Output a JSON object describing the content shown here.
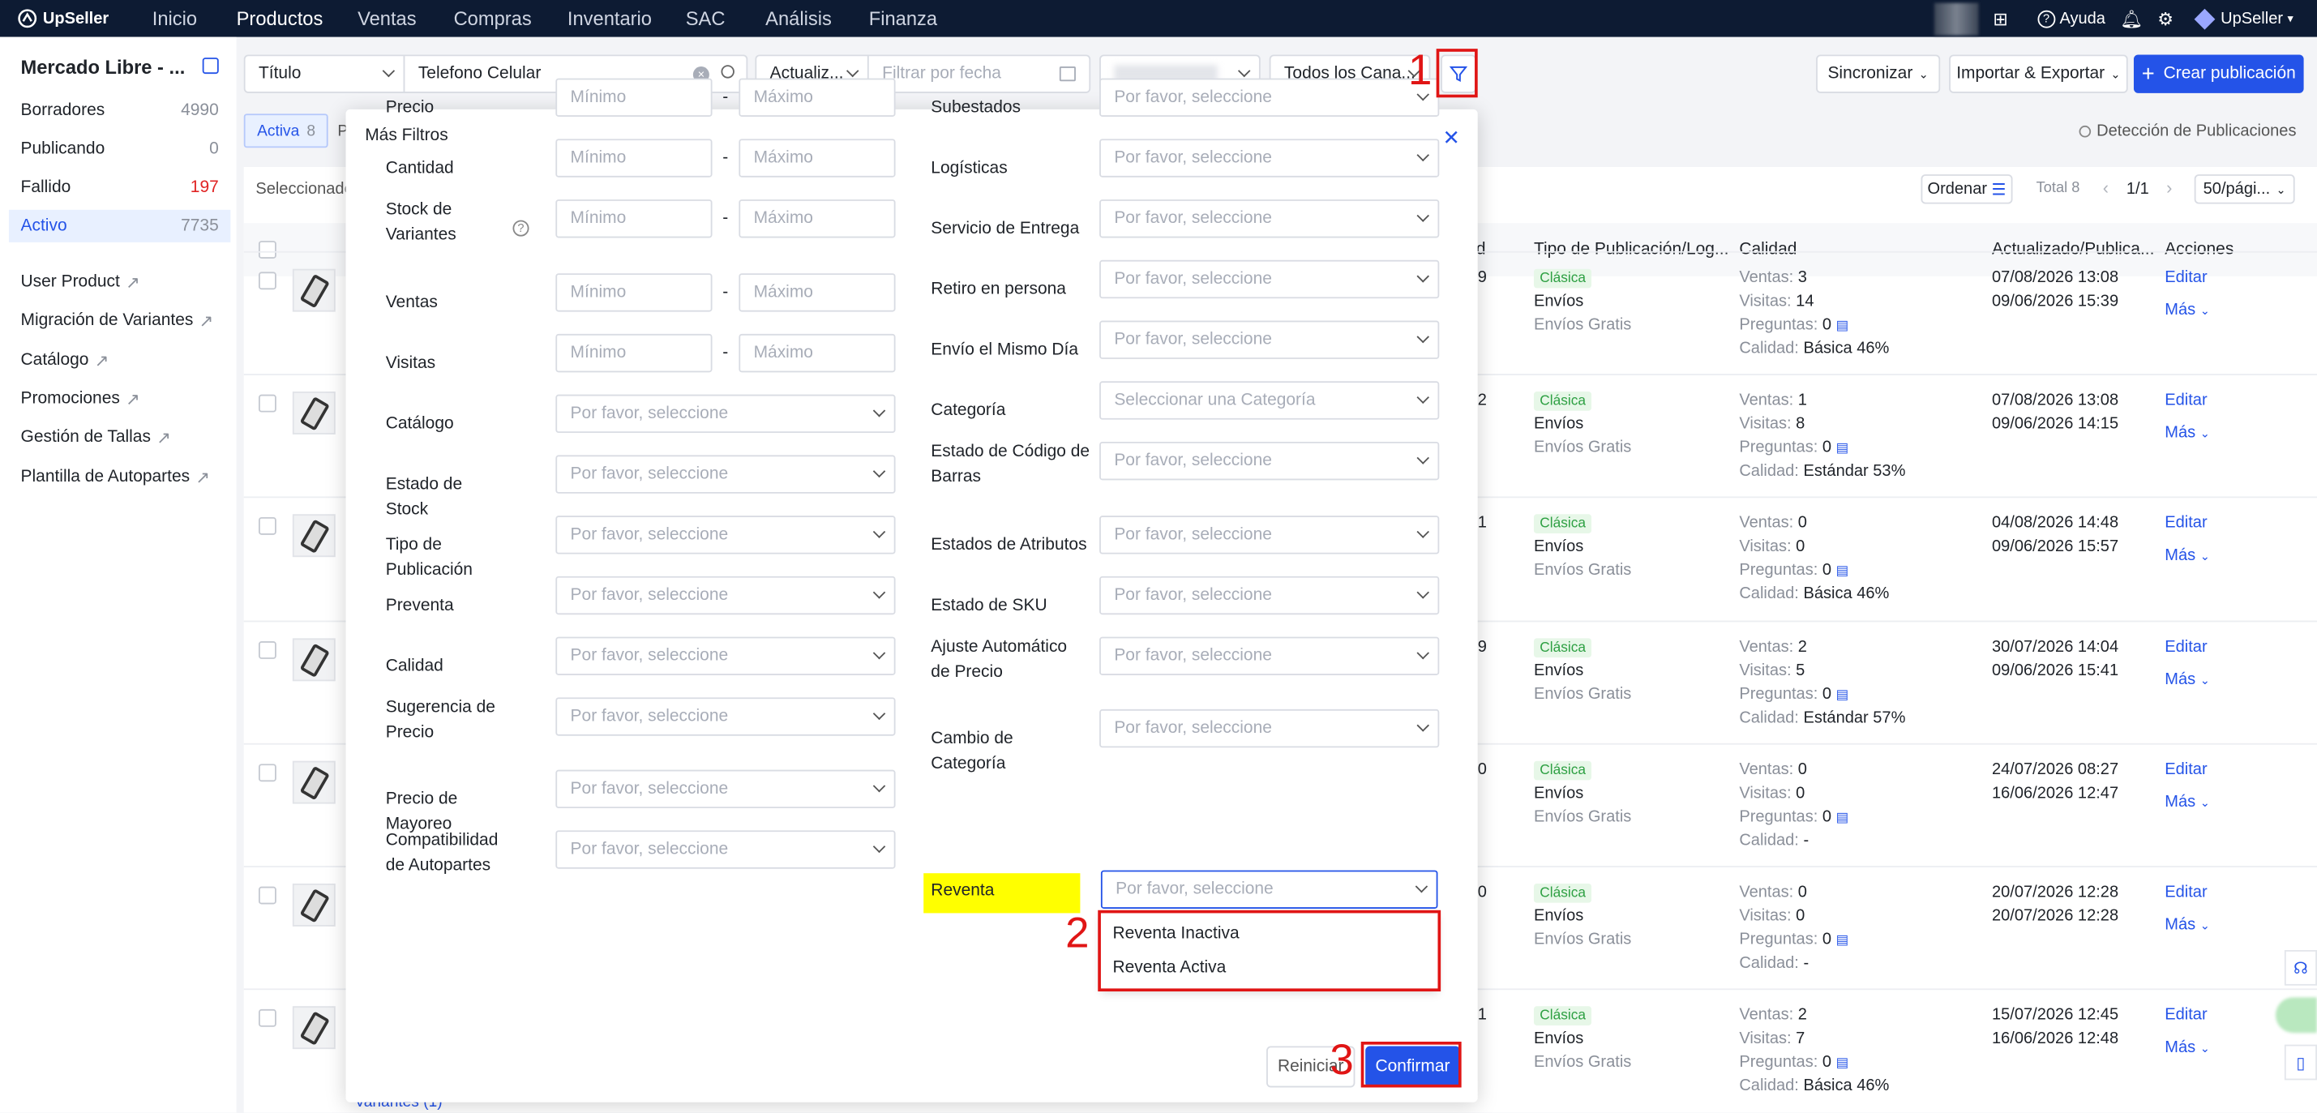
{
  "topbar": {
    "brand": "UpSeller",
    "nav": [
      "Inicio",
      "Productos",
      "Ventas",
      "Compras",
      "Inventario",
      "SAC",
      "Análisis",
      "Finanza"
    ],
    "active_nav": "Productos",
    "help": "Ayuda",
    "account": "UpSeller"
  },
  "sidebar": {
    "title": "Mercado Libre - ...",
    "items": [
      {
        "label": "Borradores",
        "count": "4990"
      },
      {
        "label": "Publicando",
        "count": "0"
      },
      {
        "label": "Fallido",
        "count": "197"
      },
      {
        "label": "Activo",
        "count": "7735"
      }
    ],
    "links": [
      "User Product",
      "Migración de Variantes",
      "Catálogo",
      "Promociones",
      "Gestión de Tallas",
      "Plantilla de Autopartes"
    ]
  },
  "toolbar": {
    "search_field": "Título",
    "search_value": "Telefono Celular",
    "date_type": "Actualiz...",
    "date_placeholder": "Filtrar por fecha",
    "channels": "Todos los Cana...",
    "sync": "Sincronizar",
    "import_export": "Importar & Exportar",
    "create": "Crear publicación",
    "detection": "Detección de Publicaciones"
  },
  "tabs": {
    "active": "Activa",
    "active_count": "8",
    "next": "P"
  },
  "listbar": {
    "selected": "Seleccionado",
    "sort": "Ordenar",
    "total": "Total 8",
    "page": "1/1",
    "per_page": "50/pági..."
  },
  "table": {
    "headers": {
      "qty": "d",
      "type": "Tipo de Publicación/Log...",
      "quality": "Calidad",
      "updated": "Actualizado/Publica...",
      "actions": "Acciones"
    },
    "quality_labels": {
      "sales": "Ventas:",
      "visits": "Visitas:",
      "questions": "Preguntas:",
      "quality": "Calidad:"
    },
    "rows": [
      {
        "qty": "9",
        "tag": "Clásica",
        "ship": "Envíos",
        "free": "Envíos Gratis",
        "sales": "3",
        "visits": "14",
        "questions": "0",
        "quality": "Básica 46%",
        "updated": "07/08/2026 13:08",
        "published": "09/06/2026 15:39",
        "edit": "Editar",
        "more": "Más"
      },
      {
        "qty": "2",
        "tag": "Clásica",
        "ship": "Envíos",
        "free": "Envíos Gratis",
        "sales": "1",
        "visits": "8",
        "questions": "0",
        "quality": "Estándar 53%",
        "updated": "07/08/2026 13:08",
        "published": "09/06/2026 14:15",
        "edit": "Editar",
        "more": "Más"
      },
      {
        "qty": "1",
        "tag": "Clásica",
        "ship": "Envíos",
        "free": "Envíos Gratis",
        "sales": "0",
        "visits": "0",
        "questions": "0",
        "quality": "Básica 46%",
        "updated": "04/08/2026 14:48",
        "published": "09/06/2026 15:57",
        "edit": "Editar",
        "more": "Más"
      },
      {
        "qty": "9",
        "tag": "Clásica",
        "ship": "Envíos",
        "free": "Envíos Gratis",
        "sales": "2",
        "visits": "5",
        "questions": "0",
        "quality": "Estándar 57%",
        "updated": "30/07/2026 14:04",
        "published": "09/06/2026 15:41",
        "edit": "Editar",
        "more": "Más"
      },
      {
        "qty": "0",
        "tag": "Clásica",
        "ship": "Envíos",
        "free": "Envíos Gratis",
        "sales": "0",
        "visits": "0",
        "questions": "0",
        "quality": "-",
        "updated": "24/07/2026 08:27",
        "published": "16/06/2026 12:47",
        "edit": "Editar",
        "more": "Más"
      },
      {
        "qty": "0",
        "tag": "Clásica",
        "ship": "Envíos",
        "free": "Envíos Gratis",
        "sales": "0",
        "visits": "0",
        "questions": "0",
        "quality": "-",
        "updated": "20/07/2026 12:28",
        "published": "20/07/2026 12:28",
        "edit": "Editar",
        "more": "Más"
      },
      {
        "qty": "1",
        "tag": "Clásica",
        "ship": "Envíos",
        "free": "Envíos Gratis",
        "sales": "2",
        "visits": "7",
        "questions": "0",
        "quality": "Básica 46%",
        "updated": "15/07/2026 12:45",
        "published": "16/06/2026 12:48",
        "edit": "Editar",
        "more": "Más"
      }
    ],
    "variants": "Variantes (1)"
  },
  "modal": {
    "title": "Más Filtros",
    "min": "Mínimo",
    "max": "Máximo",
    "select": "Por favor, seleccione",
    "category_select": "Seleccionar una Categoría",
    "left": [
      "Precio",
      "Cantidad",
      "Stock de Variantes",
      "Ventas",
      "Visitas",
      "Catálogo",
      "Estado de Stock",
      "Tipo de Publicación",
      "Preventa",
      "Calidad",
      "Sugerencia de Precio",
      "Precio de Mayoreo",
      "Compatibilidad de Autopartes"
    ],
    "right": [
      "Subestados",
      "Logísticas",
      "Servicio de Entrega",
      "Retiro en persona",
      "Envío el Mismo Día",
      "Categoría",
      "Estado de Código de Barras",
      "Estados de Atributos",
      "Estado de SKU",
      "Ajuste Automático de Precio",
      "Cambio de Categoría",
      "Reventa"
    ],
    "dropdown": [
      "Reventa Inactiva",
      "Reventa Activa"
    ],
    "reset": "Reiniciar",
    "confirm": "Confirmar"
  },
  "annotations": [
    "1",
    "2",
    "3"
  ]
}
